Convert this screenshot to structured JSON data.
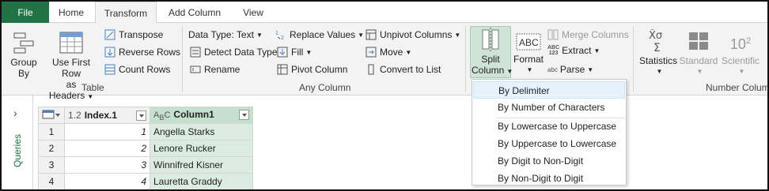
{
  "tabs": {
    "file": "File",
    "home": "Home",
    "transform": "Transform",
    "add_column": "Add Column",
    "view": "View"
  },
  "ribbon": {
    "table_group": {
      "label": "Table",
      "group_by": [
        "Group",
        "By"
      ],
      "use_first_row": [
        "Use First Row",
        "as Headers"
      ],
      "transpose": "Transpose",
      "reverse_rows": "Reverse Rows",
      "count_rows": "Count Rows"
    },
    "any_column_group": {
      "label": "Any Column",
      "data_type": "Data Type: Text",
      "detect_data_type": "Detect Data Type",
      "rename": "Rename",
      "replace_values": "Replace Values",
      "fill": "Fill",
      "pivot_column": "Pivot Column",
      "unpivot_columns": "Unpivot Columns",
      "move": "Move",
      "convert_to_list": "Convert to List"
    },
    "text_column_group": {
      "split_column": [
        "Split",
        "Column"
      ],
      "format": "Format",
      "merge_columns": "Merge Columns",
      "extract": "Extract",
      "parse": "Parse",
      "abc123_top": "ABC",
      "abc123_bottom": "123",
      "abc_small": "abc"
    },
    "number_column_group": {
      "label": "Number Column",
      "statistics": "Statistics",
      "standard": "Standard",
      "scientific": "Scientific",
      "exp_base": "10",
      "exp_sup": "2"
    }
  },
  "queries_pane": {
    "label": "Queries"
  },
  "grid": {
    "columns": [
      {
        "type": "1.2",
        "name": "Index.1"
      },
      {
        "type_a": "A",
        "type_b": "B",
        "type_c": "C",
        "name": "Column1"
      }
    ],
    "rows": [
      {
        "idx": "1",
        "index": "1",
        "name": "Angella Starks"
      },
      {
        "idx": "2",
        "index": "2",
        "name": "Lenore Rucker"
      },
      {
        "idx": "3",
        "index": "3",
        "name": "Winnifred Kisner"
      },
      {
        "idx": "4",
        "index": "4",
        "name": "Lauretta Graddy"
      }
    ]
  },
  "split_menu": {
    "items": [
      "By Delimiter",
      "By Number of Characters",
      "By Lowercase to Uppercase",
      "By Uppercase to Lowercase",
      "By Digit to Non-Digit",
      "By Non-Digit to Digit"
    ]
  },
  "colors": {
    "accent": "#217346",
    "selected_column": "#dcece2",
    "highlight": "#e5f1fb"
  }
}
